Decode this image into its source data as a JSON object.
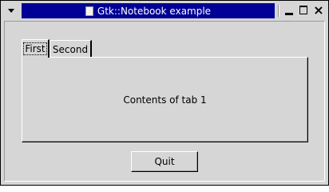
{
  "window": {
    "title": "Gtk::Notebook example",
    "title_bar_color": "#000096",
    "icons": [
      "menu-arrow-icon",
      "document-icon",
      "minimize-icon",
      "maximize-icon",
      "close-icon"
    ],
    "close_glyph": "×"
  },
  "notebook": {
    "tabs": [
      {
        "label": "First",
        "active": true
      },
      {
        "label": "Second",
        "active": false
      }
    ],
    "page_content": "Contents of tab 1"
  },
  "actions": {
    "quit_label": "Quit"
  }
}
